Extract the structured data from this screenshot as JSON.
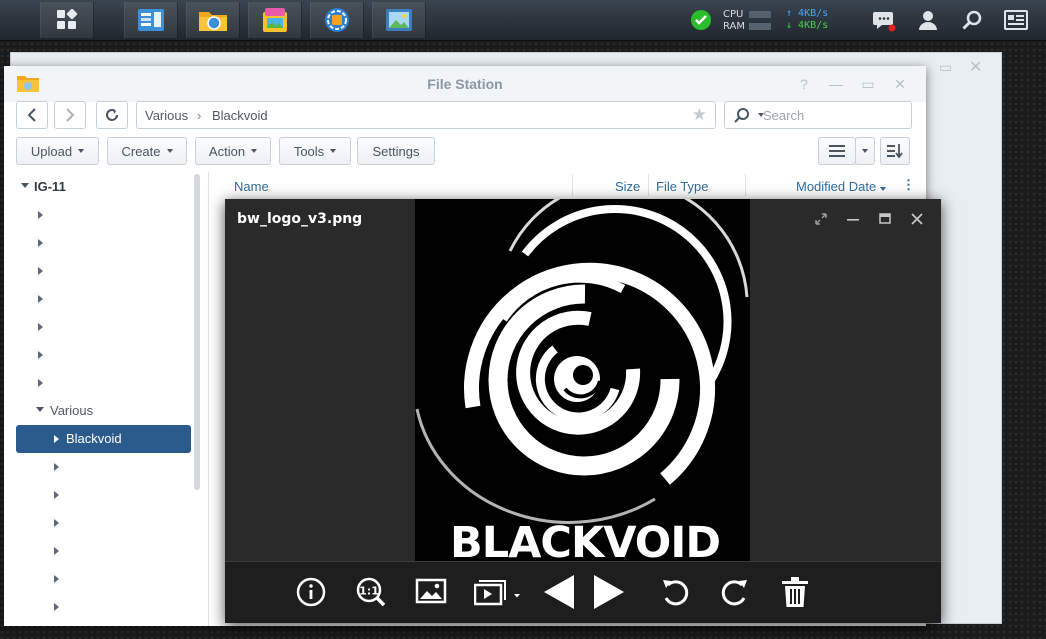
{
  "taskbar": {
    "apps": [
      {
        "icon": "main-menu-icon"
      },
      {
        "icon": "package-center-icon"
      },
      {
        "icon": "file-station-icon"
      },
      {
        "icon": "photo-station-icon"
      },
      {
        "icon": "control-panel-icon"
      },
      {
        "icon": "image-viewer-icon"
      }
    ],
    "cpu_label": "CPU",
    "ram_label": "RAM",
    "upload_speed": "4KB/s",
    "download_speed": "4KB/s",
    "status_color": "#2bbd2b",
    "upload_color": "#4aa3ff",
    "download_color": "#4ad14a"
  },
  "file_station": {
    "title": "File Station",
    "path": [
      "Various",
      "Blackvoid"
    ],
    "search_placeholder": "Search",
    "toolbar": {
      "upload": "Upload",
      "create": "Create",
      "action": "Action",
      "tools": "Tools",
      "settings": "Settings"
    },
    "tree": {
      "root": "IG-11",
      "parent": "Various",
      "selected": "Blackvoid",
      "selected_color": "#2b5a8c"
    },
    "columns": {
      "name": "Name",
      "size": "Size",
      "type": "File Type",
      "modified": "Modified Date"
    }
  },
  "viewer": {
    "filename": "bw_logo_v3.png",
    "logo_text": "BLACKVOID",
    "tools": [
      "info-icon",
      "zoom-actual-size-icon",
      "wallpaper-icon",
      "slideshow-icon",
      "previous-icon",
      "next-icon",
      "rotate-left-icon",
      "rotate-right-icon",
      "delete-icon"
    ]
  }
}
